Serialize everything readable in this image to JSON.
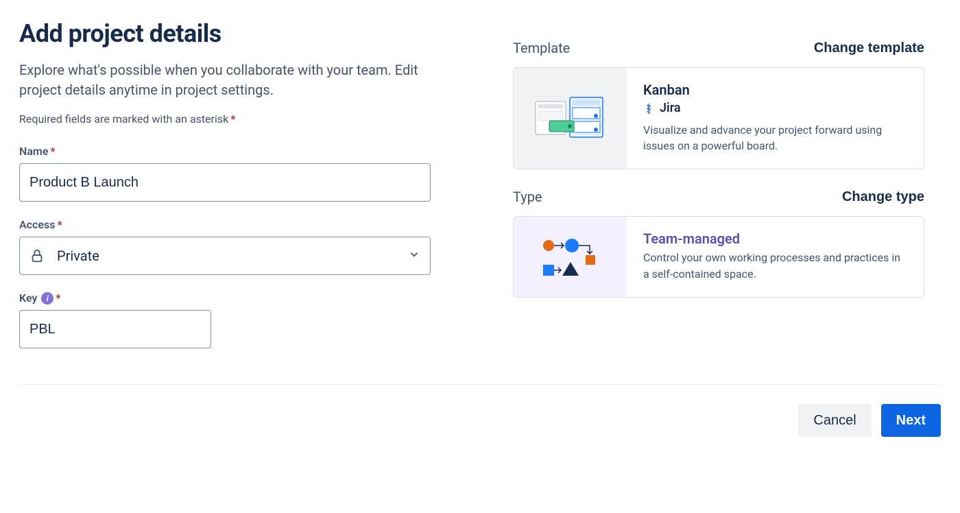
{
  "header": {
    "title": "Add project details",
    "description": "Explore what's possible when you collaborate with your team. Edit project details anytime in project settings.",
    "required_note": "Required fields are marked with an asterisk"
  },
  "form": {
    "name": {
      "label": "Name",
      "value": "Product B Launch"
    },
    "access": {
      "label": "Access",
      "value": "Private"
    },
    "key": {
      "label": "Key",
      "value": "PBL"
    }
  },
  "template": {
    "section_label": "Template",
    "change_label": "Change template",
    "title": "Kanban",
    "product": "Jira",
    "description": "Visualize and advance your project forward using issues on a powerful board."
  },
  "type": {
    "section_label": "Type",
    "change_label": "Change type",
    "title": "Team-managed",
    "description": "Control your own working processes and practices in a self-contained space."
  },
  "footer": {
    "cancel": "Cancel",
    "next": "Next"
  }
}
